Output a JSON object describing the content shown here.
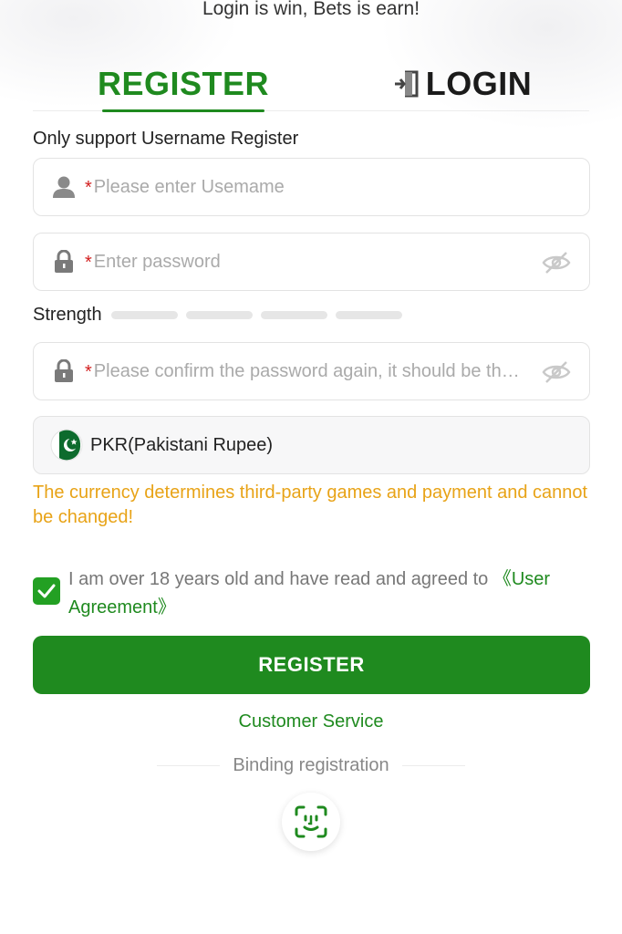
{
  "slogan": "Login is win, Bets is earn!",
  "tabs": {
    "register": "REGISTER",
    "login": "LOGIN"
  },
  "form": {
    "support_label": "Only support Username Register",
    "username": {
      "required_mark": "*",
      "placeholder": "Please enter Usemame",
      "icon": "user-icon"
    },
    "password": {
      "required_mark": "*",
      "placeholder": "Enter password",
      "icon": "lock-icon",
      "toggle_icon": "eye-off-icon"
    },
    "strength": {
      "label": "Strength",
      "level": 0,
      "segments": 4
    },
    "confirm": {
      "required_mark": "*",
      "placeholder": "Please confirm the password again, it should be the…",
      "icon": "lock-icon",
      "toggle_icon": "eye-off-icon"
    },
    "currency": {
      "value": "PKR(Pakistani Rupee)",
      "icon": "pkr-flag-icon"
    },
    "currency_warning": "The currency determines third-party games and payment and cannot be changed!",
    "agreement": {
      "checked": true,
      "text": "I am over 18 years old and have read and agreed to ",
      "link": "《User Agreement》"
    },
    "submit_label": "REGISTER"
  },
  "customer_service": "Customer Service",
  "binding_label": "Binding registration",
  "colors": {
    "brand_green": "#1f8a1f",
    "warning": "#e8a317",
    "required": "#d21f1f"
  }
}
